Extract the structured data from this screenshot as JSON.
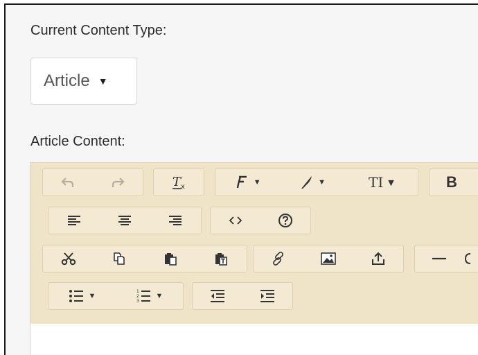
{
  "form": {
    "content_type_label": "Current Content Type:",
    "content_type_value": "Article",
    "content_label": "Article Content:"
  },
  "toolbar": {
    "groups": [
      {
        "name": "history",
        "buttons": [
          "undo",
          "redo"
        ]
      },
      {
        "name": "clear",
        "buttons": [
          "clear-formatting"
        ]
      },
      {
        "name": "font",
        "buttons": [
          "font-family",
          "highlight",
          "font-size"
        ]
      },
      {
        "name": "style",
        "buttons": [
          "bold"
        ]
      },
      {
        "name": "align",
        "buttons": [
          "align-left",
          "align-center",
          "align-right"
        ]
      },
      {
        "name": "misc",
        "buttons": [
          "code-view",
          "help"
        ]
      },
      {
        "name": "clipboard",
        "buttons": [
          "cut",
          "copy",
          "paste",
          "paste-text"
        ]
      },
      {
        "name": "insert",
        "buttons": [
          "link",
          "image",
          "upload"
        ]
      },
      {
        "name": "rule",
        "buttons": [
          "horizontal-rule"
        ]
      },
      {
        "name": "lists",
        "buttons": [
          "bullet-list",
          "numbered-list"
        ]
      },
      {
        "name": "indent",
        "buttons": [
          "outdent",
          "indent"
        ]
      }
    ],
    "font_size_glyph": "TI",
    "bold_glyph": "B"
  },
  "colors": {
    "toolbar_bg": "#f0e4c8",
    "button_group_bg": "#f4ead3",
    "panel_bg": "#f6f6f6"
  }
}
